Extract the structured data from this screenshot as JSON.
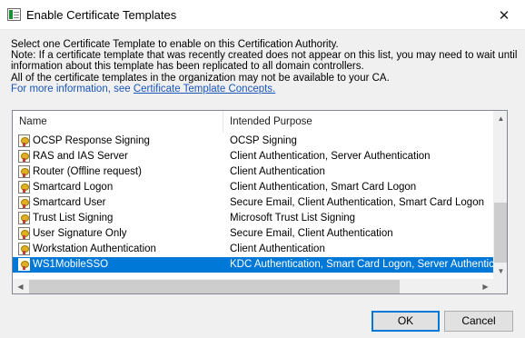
{
  "window": {
    "title": "Enable Certificate Templates",
    "close_glyph": "✕"
  },
  "description": {
    "line1": "Select one Certificate Template to enable on this Certification Authority.",
    "line2": "Note: If a certificate template that was recently created does not appear on this list, you may need to wait until",
    "line3": "information about this template has been replicated to all domain controllers.",
    "line4": "All of the certificate templates in the organization may not be available to your CA.",
    "more_info_prefix": "For more information, see ",
    "more_info_link": "Certificate Template Concepts."
  },
  "list": {
    "columns": [
      "Name",
      "Intended Purpose"
    ],
    "rows": [
      {
        "name": "OCSP Response Signing",
        "purpose": "OCSP Signing",
        "icon": "certificate-template-icon",
        "selected": false
      },
      {
        "name": "RAS and IAS Server",
        "purpose": "Client Authentication, Server Authentication",
        "icon": "certificate-template-icon",
        "selected": false
      },
      {
        "name": "Router (Offline request)",
        "purpose": "Client Authentication",
        "icon": "certificate-template-icon",
        "selected": false
      },
      {
        "name": "Smartcard Logon",
        "purpose": "Client Authentication, Smart Card Logon",
        "icon": "certificate-template-icon",
        "selected": false
      },
      {
        "name": "Smartcard User",
        "purpose": "Secure Email, Client Authentication, Smart Card Logon",
        "icon": "certificate-template-icon",
        "selected": false
      },
      {
        "name": "Trust List Signing",
        "purpose": "Microsoft Trust List Signing",
        "icon": "certificate-template-icon",
        "selected": false
      },
      {
        "name": "User Signature Only",
        "purpose": "Secure Email, Client Authentication",
        "icon": "certificate-template-icon",
        "selected": false
      },
      {
        "name": "Workstation Authentication",
        "purpose": "Client Authentication",
        "icon": "certificate-template-icon",
        "selected": false
      },
      {
        "name": "WS1MobileSSO",
        "purpose": "KDC Authentication, Smart Card Logon, Server Authentication",
        "icon": "certificate-template-icon",
        "selected": true
      }
    ]
  },
  "buttons": {
    "ok": "OK",
    "cancel": "Cancel"
  },
  "colors": {
    "selection": "#0078d7",
    "link": "#1a55b8"
  }
}
